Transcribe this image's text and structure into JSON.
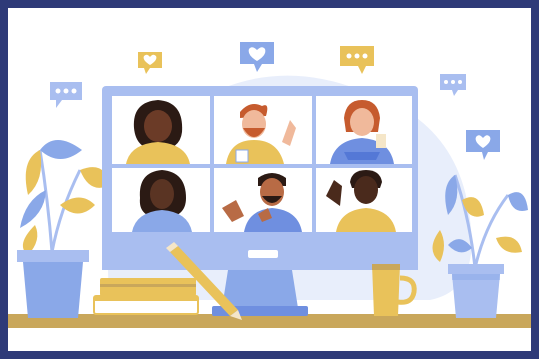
{
  "illustration": {
    "subject": "video-conference",
    "icons": {
      "chat_bubbles": [
        "heart-icon",
        "typing-dots-icon"
      ],
      "desk_items": [
        "books-icon",
        "pencil-icon",
        "mug-icon",
        "plant-icon"
      ]
    },
    "participant_count": 6,
    "colors": {
      "frame_border": "#2e3a78",
      "background": "#ffffff",
      "bg_blob": "#e8eefb",
      "screen_blue": "#a9bef0",
      "screen_dark": "#6f8fe0",
      "tile": "#ffffff",
      "accent_yellow": "#e9c25a",
      "desk": "#c9a75b",
      "leaf_blue": "#8aa8e8",
      "skin_dark": "#5a3423",
      "skin_mid": "#b86b45",
      "skin_light": "#f0b99b"
    }
  }
}
